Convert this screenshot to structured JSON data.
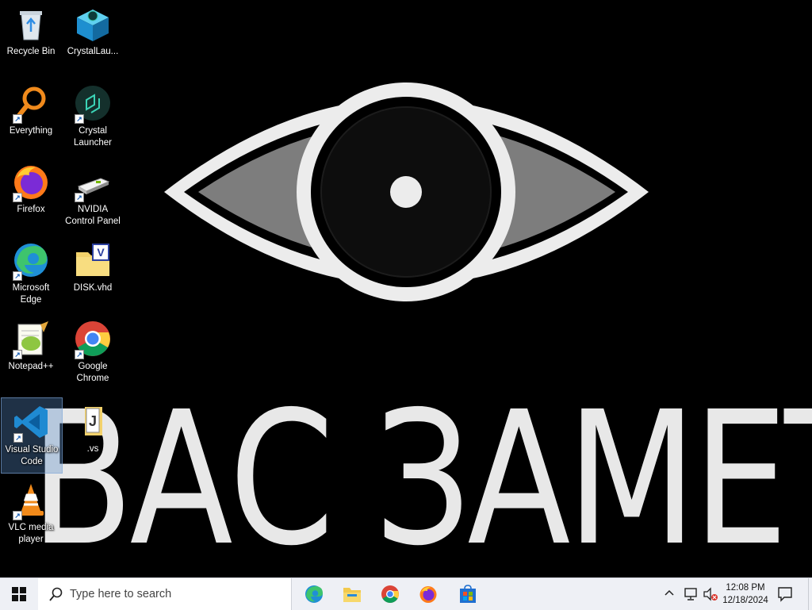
{
  "wallpaper": {
    "text": "ВАС ЗАМЕТИЛИ"
  },
  "desktop_icons": [
    {
      "label": "Recycle Bin",
      "icon": "recycle-bin-icon"
    },
    {
      "label": "CrystalLau...",
      "icon": "crystal-launcher-box-icon"
    },
    {
      "label": "Everything",
      "icon": "everything-search-icon"
    },
    {
      "label": "Crystal\nLauncher",
      "icon": "crystal-launcher-icon"
    },
    {
      "label": "Firefox",
      "icon": "firefox-icon"
    },
    {
      "label": "NVIDIA\nControl Panel",
      "icon": "nvidia-control-panel-icon"
    },
    {
      "label": "Microsoft\nEdge",
      "icon": "edge-icon"
    },
    {
      "label": "DISK.vhd",
      "icon": "vhd-file-icon"
    },
    {
      "label": "Notepad++",
      "icon": "notepadpp-icon"
    },
    {
      "label": "Google\nChrome",
      "icon": "chrome-icon"
    },
    {
      "label": "Visual Studio\nCode",
      "icon": "vscode-icon"
    },
    {
      "label": ".vs",
      "icon": "vs-folder-icon"
    },
    {
      "label": "VLC media\nplayer",
      "icon": "vlc-icon"
    }
  ],
  "taskbar": {
    "search_placeholder": "Type here to search",
    "pinned": [
      "edge-icon",
      "file-explorer-icon",
      "chrome-icon",
      "firefox-icon",
      "store-icon"
    ],
    "clock": {
      "time": "12:08 PM",
      "date": "12/18/2024"
    }
  }
}
